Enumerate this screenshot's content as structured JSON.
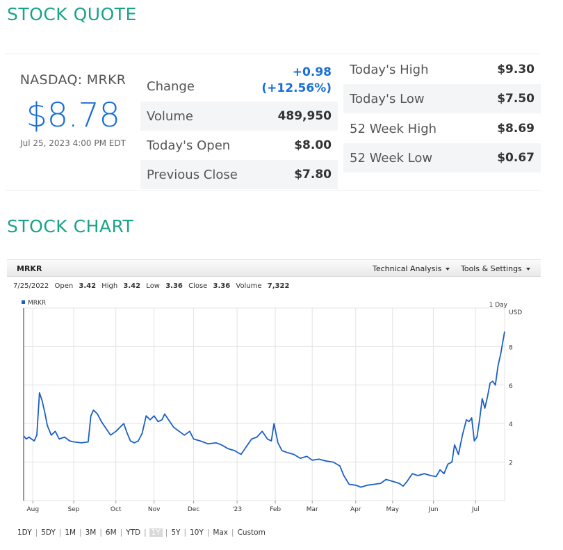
{
  "quote_section": {
    "title": "STOCK QUOTE",
    "ticker": "NASDAQ: MRKR",
    "price": "$8.78",
    "timestamp": "Jul 25, 2023 4:00 PM EDT",
    "rows_left": [
      {
        "label": "Change",
        "value_line1": "+0.98",
        "value_line2": "(+12.56%)"
      },
      {
        "label": "Volume",
        "value": "489,950"
      },
      {
        "label": "Today's Open",
        "value": "$8.00"
      },
      {
        "label": "Previous Close",
        "value": "$7.80"
      }
    ],
    "rows_right": [
      {
        "label": "Today's High",
        "value": "$9.30"
      },
      {
        "label": "Today's Low",
        "value": "$7.50"
      },
      {
        "label": "52 Week High",
        "value": "$8.69"
      },
      {
        "label": "52 Week Low",
        "value": "$0.67"
      }
    ],
    "up_color": "#1a6fd6"
  },
  "chart_section": {
    "title": "STOCK CHART",
    "toolbar": {
      "symbol": "MRKR",
      "technical_analysis": "Technical Analysis",
      "tools_settings": "Tools & Settings"
    },
    "ohlc": {
      "date": "7/25/2022",
      "open_label": "Open",
      "open": "3.42",
      "high_label": "High",
      "high": "3.42",
      "low_label": "Low",
      "low": "3.36",
      "close_label": "Close",
      "close": "3.36",
      "volume_label": "Volume",
      "volume": "7,322"
    },
    "ranges": [
      "1DY",
      "5DY",
      "1M",
      "3M",
      "6M",
      "YTD",
      "1Y",
      "5Y",
      "10Y",
      "Max",
      "Custom"
    ],
    "active_range": "1Y"
  },
  "chart_data": {
    "type": "line",
    "legend": "MRKR",
    "interval_label": "1 Day",
    "currency_label": "USD",
    "line_color": "#1a5fc6",
    "legend_position": "top-left",
    "grid": true,
    "ylim": [
      0,
      10
    ],
    "yticks": [
      2,
      4,
      6,
      8
    ],
    "xlim": [
      "2022-07-25",
      "2023-07-25"
    ],
    "xticks": [
      {
        "label": "Aug",
        "date": "2022-08-01"
      },
      {
        "label": "Sep",
        "date": "2022-09-01"
      },
      {
        "label": "Oct",
        "date": "2022-10-03"
      },
      {
        "label": "Nov",
        "date": "2022-11-01"
      },
      {
        "label": "Dec",
        "date": "2022-12-01"
      },
      {
        "label": "'23",
        "date": "2023-01-03"
      },
      {
        "label": "Feb",
        "date": "2023-02-01"
      },
      {
        "label": "Mar",
        "date": "2023-03-01"
      },
      {
        "label": "Apr",
        "date": "2023-04-03"
      },
      {
        "label": "May",
        "date": "2023-05-01"
      },
      {
        "label": "Jun",
        "date": "2023-06-01"
      },
      {
        "label": "Jul",
        "date": "2023-07-03"
      }
    ],
    "series": [
      {
        "name": "MRKR",
        "points": [
          [
            "2022-07-25",
            3.36
          ],
          [
            "2022-07-27",
            3.2
          ],
          [
            "2022-07-29",
            3.3
          ],
          [
            "2022-08-02",
            3.1
          ],
          [
            "2022-08-04",
            3.4
          ],
          [
            "2022-08-06",
            5.6
          ],
          [
            "2022-08-08",
            5.2
          ],
          [
            "2022-08-10",
            4.6
          ],
          [
            "2022-08-12",
            3.9
          ],
          [
            "2022-08-15",
            3.4
          ],
          [
            "2022-08-18",
            3.6
          ],
          [
            "2022-08-21",
            3.2
          ],
          [
            "2022-08-25",
            3.3
          ],
          [
            "2022-08-29",
            3.1
          ],
          [
            "2022-09-01",
            3.05
          ],
          [
            "2022-09-07",
            3.0
          ],
          [
            "2022-09-12",
            3.05
          ],
          [
            "2022-09-14",
            4.4
          ],
          [
            "2022-09-16",
            4.7
          ],
          [
            "2022-09-19",
            4.5
          ],
          [
            "2022-09-22",
            4.1
          ],
          [
            "2022-09-26",
            3.7
          ],
          [
            "2022-09-29",
            3.4
          ],
          [
            "2022-10-03",
            3.6
          ],
          [
            "2022-10-06",
            3.8
          ],
          [
            "2022-10-09",
            4.0
          ],
          [
            "2022-10-11",
            3.6
          ],
          [
            "2022-10-14",
            3.1
          ],
          [
            "2022-10-17",
            3.0
          ],
          [
            "2022-10-20",
            3.1
          ],
          [
            "2022-10-23",
            3.5
          ],
          [
            "2022-10-26",
            4.4
          ],
          [
            "2022-10-29",
            4.2
          ],
          [
            "2022-11-01",
            4.4
          ],
          [
            "2022-11-04",
            4.1
          ],
          [
            "2022-11-07",
            4.2
          ],
          [
            "2022-11-09",
            4.5
          ],
          [
            "2022-11-12",
            4.2
          ],
          [
            "2022-11-16",
            3.8
          ],
          [
            "2022-11-20",
            3.6
          ],
          [
            "2022-11-24",
            3.4
          ],
          [
            "2022-11-28",
            3.6
          ],
          [
            "2022-12-01",
            3.2
          ],
          [
            "2022-12-06",
            3.1
          ],
          [
            "2022-12-12",
            2.95
          ],
          [
            "2022-12-18",
            3.0
          ],
          [
            "2022-12-22",
            2.9
          ],
          [
            "2022-12-27",
            2.7
          ],
          [
            "2023-01-01",
            2.6
          ],
          [
            "2023-01-06",
            2.4
          ],
          [
            "2023-01-10",
            2.8
          ],
          [
            "2023-01-14",
            3.2
          ],
          [
            "2023-01-18",
            3.3
          ],
          [
            "2023-01-22",
            3.6
          ],
          [
            "2023-01-26",
            3.2
          ],
          [
            "2023-01-29",
            3.1
          ],
          [
            "2023-01-31",
            4.0
          ],
          [
            "2023-02-03",
            3.0
          ],
          [
            "2023-02-06",
            2.6
          ],
          [
            "2023-02-10",
            2.5
          ],
          [
            "2023-02-15",
            2.4
          ],
          [
            "2023-02-20",
            2.2
          ],
          [
            "2023-02-25",
            2.3
          ],
          [
            "2023-03-01",
            2.1
          ],
          [
            "2023-03-06",
            2.15
          ],
          [
            "2023-03-12",
            2.05
          ],
          [
            "2023-03-17",
            2.0
          ],
          [
            "2023-03-22",
            1.8
          ],
          [
            "2023-03-25",
            1.3
          ],
          [
            "2023-03-29",
            0.85
          ],
          [
            "2023-04-03",
            0.8
          ],
          [
            "2023-04-07",
            0.7
          ],
          [
            "2023-04-12",
            0.8
          ],
          [
            "2023-04-17",
            0.85
          ],
          [
            "2023-04-22",
            0.9
          ],
          [
            "2023-04-26",
            1.1
          ],
          [
            "2023-05-01",
            1.0
          ],
          [
            "2023-05-06",
            0.9
          ],
          [
            "2023-05-09",
            0.75
          ],
          [
            "2023-05-12",
            1.0
          ],
          [
            "2023-05-16",
            1.4
          ],
          [
            "2023-05-20",
            1.3
          ],
          [
            "2023-05-25",
            1.4
          ],
          [
            "2023-05-30",
            1.3
          ],
          [
            "2023-06-03",
            1.25
          ],
          [
            "2023-06-06",
            1.6
          ],
          [
            "2023-06-09",
            1.4
          ],
          [
            "2023-06-12",
            1.9
          ],
          [
            "2023-06-15",
            2.0
          ],
          [
            "2023-06-17",
            2.9
          ],
          [
            "2023-06-20",
            2.4
          ],
          [
            "2023-06-23",
            3.4
          ],
          [
            "2023-06-26",
            4.2
          ],
          [
            "2023-06-28",
            4.1
          ],
          [
            "2023-06-30",
            4.3
          ],
          [
            "2023-07-02",
            3.1
          ],
          [
            "2023-07-04",
            3.3
          ],
          [
            "2023-07-06",
            4.2
          ],
          [
            "2023-07-08",
            5.3
          ],
          [
            "2023-07-10",
            4.8
          ],
          [
            "2023-07-12",
            5.4
          ],
          [
            "2023-07-14",
            6.1
          ],
          [
            "2023-07-16",
            6.2
          ],
          [
            "2023-07-18",
            6.0
          ],
          [
            "2023-07-20",
            7.0
          ],
          [
            "2023-07-22",
            7.6
          ],
          [
            "2023-07-25",
            8.78
          ]
        ]
      }
    ]
  }
}
